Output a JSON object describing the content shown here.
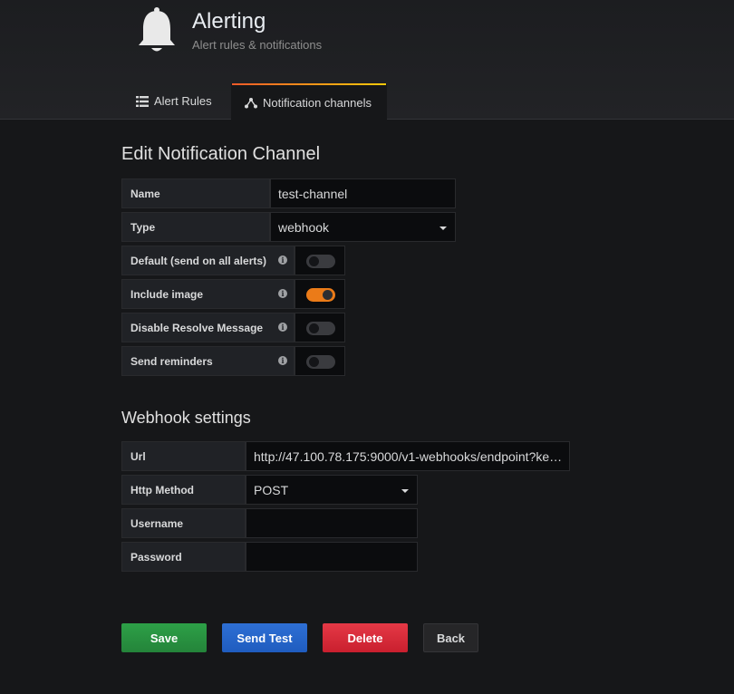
{
  "header": {
    "title": "Alerting",
    "subtitle": "Alert rules & notifications",
    "icon": "bell-icon"
  },
  "tabs": [
    {
      "label": "Alert Rules",
      "icon": "list-icon",
      "active": false
    },
    {
      "label": "Notification channels",
      "icon": "share-nodes-icon",
      "active": true
    }
  ],
  "edit": {
    "heading": "Edit Notification Channel",
    "name_label": "Name",
    "name_value": "test-channel",
    "type_label": "Type",
    "type_value": "webhook",
    "default_label": "Default (send on all alerts)",
    "default_on": false,
    "include_image_label": "Include image",
    "include_image_on": true,
    "disable_resolve_label": "Disable Resolve Message",
    "disable_resolve_on": false,
    "send_reminders_label": "Send reminders",
    "send_reminders_on": false
  },
  "webhook": {
    "heading": "Webhook settings",
    "url_label": "Url",
    "url_value": "http://47.100.78.175:9000/v1-webhooks/endpoint?ke…",
    "method_label": "Http Method",
    "method_value": "POST",
    "username_label": "Username",
    "username_value": "",
    "password_label": "Password",
    "password_value": ""
  },
  "buttons": {
    "save": "Save",
    "send_test": "Send Test",
    "delete": "Delete",
    "back": "Back"
  },
  "colors": {
    "toggle_on": "#eb7b18",
    "save": "#2da047",
    "send_test": "#2e6fd4",
    "delete": "#e53946"
  }
}
